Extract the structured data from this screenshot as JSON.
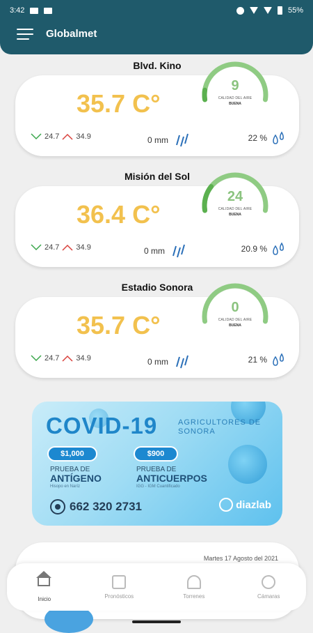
{
  "status_bar": {
    "time": "3:42",
    "battery": "55%"
  },
  "app": {
    "title": "Globalmet"
  },
  "stations": [
    {
      "name": "Blvd. Kino",
      "temperature": "35.7 C°",
      "min": "24.7",
      "max": "34.9",
      "rain": "0 mm",
      "humidity": "22 %",
      "aqi": {
        "value": "9",
        "label": "CALIDAD DEL AIRE",
        "quality": "BUENA",
        "level": 0.09
      }
    },
    {
      "name": "Misión del Sol",
      "temperature": "36.4 C°",
      "min": "24.7",
      "max": "34.9",
      "rain": "0 mm",
      "humidity": "20.9 %",
      "aqi": {
        "value": "24",
        "label": "CALIDAD DEL AIRE",
        "quality": "BUENA",
        "level": 0.24
      }
    },
    {
      "name": "Estadio Sonora",
      "temperature": "35.7 C°",
      "min": "24.7",
      "max": "34.9",
      "rain": "0 mm",
      "humidity": "21 %",
      "aqi": {
        "value": "0",
        "label": "CALIDAD DEL AIRE",
        "quality": "BUENA",
        "level": 0.0
      }
    }
  ],
  "banner": {
    "title": "COVID-19",
    "subtitle": "AGRICULTORES DE SONORA",
    "tests": [
      {
        "price": "$1,000",
        "label": "PRUEBA DE",
        "name": "ANTÍGENO",
        "note": "Hisopo en Naríz"
      },
      {
        "price": "$900",
        "label": "PRUEBA DE",
        "name": "ANTICUERPOS",
        "note": "IGG - IGM Cuantificado"
      }
    ],
    "phone": "662 320 2731",
    "brand": "diazlab"
  },
  "bottom_card": {
    "date": "Martes 17 Agosto del 2021"
  },
  "nav": {
    "items": [
      {
        "label": "Inicio",
        "icon": "home-icon"
      },
      {
        "label": "Pronósticos",
        "icon": "chart-icon"
      },
      {
        "label": "Torrenes",
        "icon": "tower-icon"
      },
      {
        "label": "Cámaras",
        "icon": "camera-icon"
      }
    ]
  }
}
